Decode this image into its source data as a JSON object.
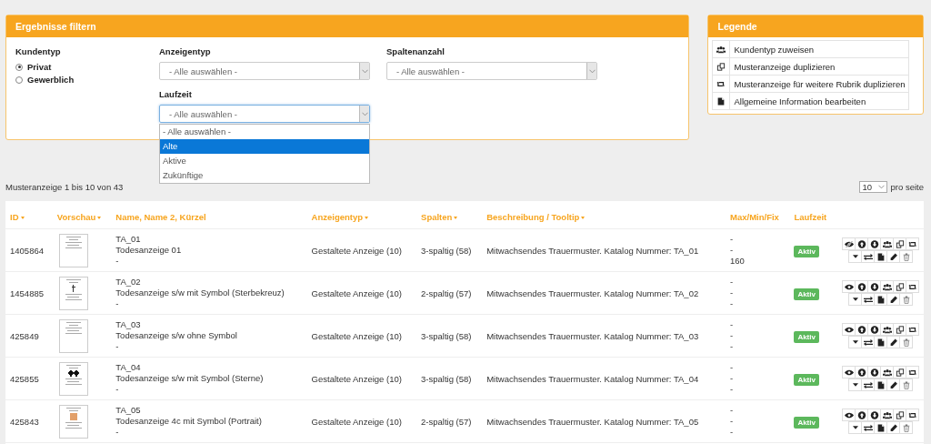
{
  "filter": {
    "title": "Ergebnisse filtern",
    "kundentyp": {
      "label": "Kundentyp",
      "options": [
        {
          "label": "Privat",
          "selected": true
        },
        {
          "label": "Gewerblich",
          "selected": false
        }
      ]
    },
    "anzeigentyp": {
      "label": "Anzeigentyp",
      "value": "- Alle auswählen -"
    },
    "spaltenanzahl": {
      "label": "Spaltenanzahl",
      "value": "- Alle auswählen -"
    },
    "laufzeit": {
      "label": "Laufzeit",
      "value": "- Alle auswählen -",
      "expanded": true,
      "options": [
        {
          "label": "- Alle auswählen -",
          "highlighted": false
        },
        {
          "label": "Alte",
          "highlighted": true
        },
        {
          "label": "Aktive",
          "highlighted": false
        },
        {
          "label": "Zukünftige",
          "highlighted": false
        }
      ]
    }
  },
  "legend": {
    "title": "Legende",
    "items": [
      {
        "kind": "users",
        "label": "Kundentyp zuweisen"
      },
      {
        "kind": "copy",
        "label": "Musteranzeige duplizieren"
      },
      {
        "kind": "retweet",
        "label": "Musteranzeige für weitere Rubrik duplizieren"
      },
      {
        "kind": "file",
        "label": "Allgemeine Information bearbeiten"
      }
    ]
  },
  "count_text": "Musteranzeige 1 bis 10 von 43",
  "page_size": {
    "value": "10",
    "label": "pro seite"
  },
  "table": {
    "columns": [
      {
        "label": "ID",
        "sortable": true
      },
      {
        "label": "Vorschau",
        "sortable": true
      },
      {
        "label": "Name, Name 2, Kürzel",
        "sortable": false
      },
      {
        "label": "Anzeigentyp",
        "sortable": true
      },
      {
        "label": "Spalten",
        "sortable": true
      },
      {
        "label": "Beschreibung / Tooltip",
        "sortable": true
      },
      {
        "label": "Max/Min/Fix",
        "sortable": false
      },
      {
        "label": "Laufzeit",
        "sortable": false
      }
    ],
    "rows": [
      {
        "id": "1405864",
        "preview": {
          "kind": "plain"
        },
        "name": "TA_01",
        "name_2": "Todesanzeige 01",
        "kuerzel": "-",
        "type": "Gestaltete Anzeige (10)",
        "columns": "3-spaltig (58)",
        "description": "Mitwachsendes Trauermuster. Katalog Nummer: TA_01",
        "max": "-",
        "min": "-",
        "fix": "160",
        "status": "Aktiv",
        "visible": false
      },
      {
        "id": "1454885",
        "preview": {
          "kind": "cross"
        },
        "name": "TA_02",
        "name_2": "Todesanzeige s/w mit Symbol (Sterbekreuz)",
        "kuerzel": "-",
        "type": "Gestaltete Anzeige (10)",
        "columns": "2-spaltig (57)",
        "description": "Mitwachsendes Trauermuster. Katalog Nummer: TA_02",
        "max": "-",
        "min": "-",
        "fix": "-",
        "status": "Aktiv",
        "visible": true
      },
      {
        "id": "425849",
        "preview": {
          "kind": "plain"
        },
        "name": "TA_03",
        "name_2": "Todesanzeige s/w ohne Symbol",
        "kuerzel": "-",
        "type": "Gestaltete Anzeige (10)",
        "columns": "3-spaltig (58)",
        "description": "Mitwachsendes Trauermuster. Katalog Nummer: TA_03",
        "max": "-",
        "min": "-",
        "fix": "-",
        "status": "Aktiv",
        "visible": true
      },
      {
        "id": "425855",
        "preview": {
          "kind": "stars"
        },
        "name": "TA_04",
        "name_2": "Todesanzeige s/w mit Symbol (Sterne)",
        "kuerzel": "-",
        "type": "Gestaltete Anzeige (10)",
        "columns": "3-spaltig (58)",
        "description": "Mitwachsendes Trauermuster. Katalog Nummer: TA_04",
        "max": "-",
        "min": "-",
        "fix": "-",
        "status": "Aktiv",
        "visible": true
      },
      {
        "id": "425843",
        "preview": {
          "kind": "portrait"
        },
        "name": "TA_05",
        "name_2": "Todesanzeige 4c mit Symbol (Portrait)",
        "kuerzel": "-",
        "type": "Gestaltete Anzeige (10)",
        "columns": "2-spaltig (57)",
        "description": "Mitwachsendes Trauermuster. Katalog Nummer: TA_05",
        "max": "-",
        "min": "-",
        "fix": "-",
        "status": "Aktiv",
        "visible": true
      }
    ]
  }
}
